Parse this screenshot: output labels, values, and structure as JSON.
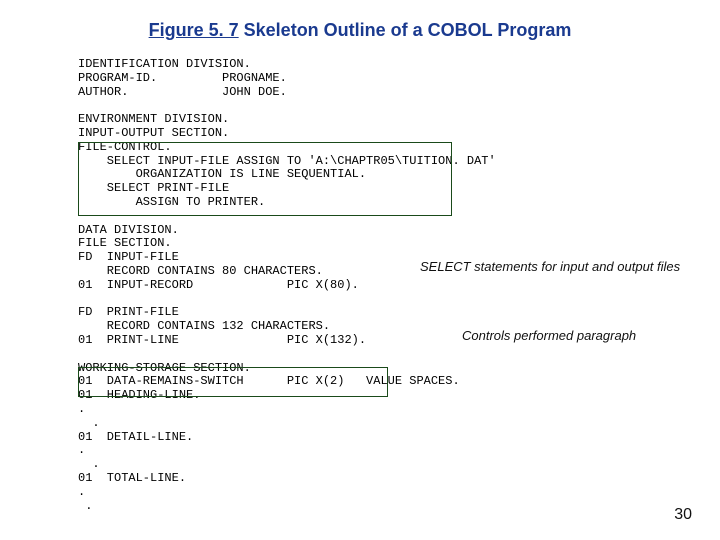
{
  "title": {
    "prefix": "Figure 5. 7",
    "rest": "Skeleton Outline of a COBOL Program"
  },
  "code": "IDENTIFICATION DIVISION.\nPROGRAM-ID.         PROGNAME.\nAUTHOR.             JOHN DOE.\n\nENVIRONMENT DIVISION.\nINPUT-OUTPUT SECTION.\nFILE-CONTROL.\n    SELECT INPUT-FILE ASSIGN TO 'A:\\CHAPTR05\\TUITION. DAT'\n        ORGANIZATION IS LINE SEQUENTIAL.\n    SELECT PRINT-FILE\n        ASSIGN TO PRINTER.\n\nDATA DIVISION.\nFILE SECTION.\nFD  INPUT-FILE\n    RECORD CONTAINS 80 CHARACTERS.\n01  INPUT-RECORD             PIC X(80).\n\nFD  PRINT-FILE\n    RECORD CONTAINS 132 CHARACTERS.\n01  PRINT-LINE               PIC X(132).\n\nWORKING-STORAGE SECTION.\n01  DATA-REMAINS-SWITCH      PIC X(2)   VALUE SPACES.\n01  HEADING-LINE.\n.\n  .\n01  DETAIL-LINE.\n.\n  .\n01  TOTAL-LINE.\n.\n .",
  "notes": {
    "n1": "SELECT statements for input and output files",
    "n2": "Controls performed paragraph"
  },
  "page_number": "30"
}
